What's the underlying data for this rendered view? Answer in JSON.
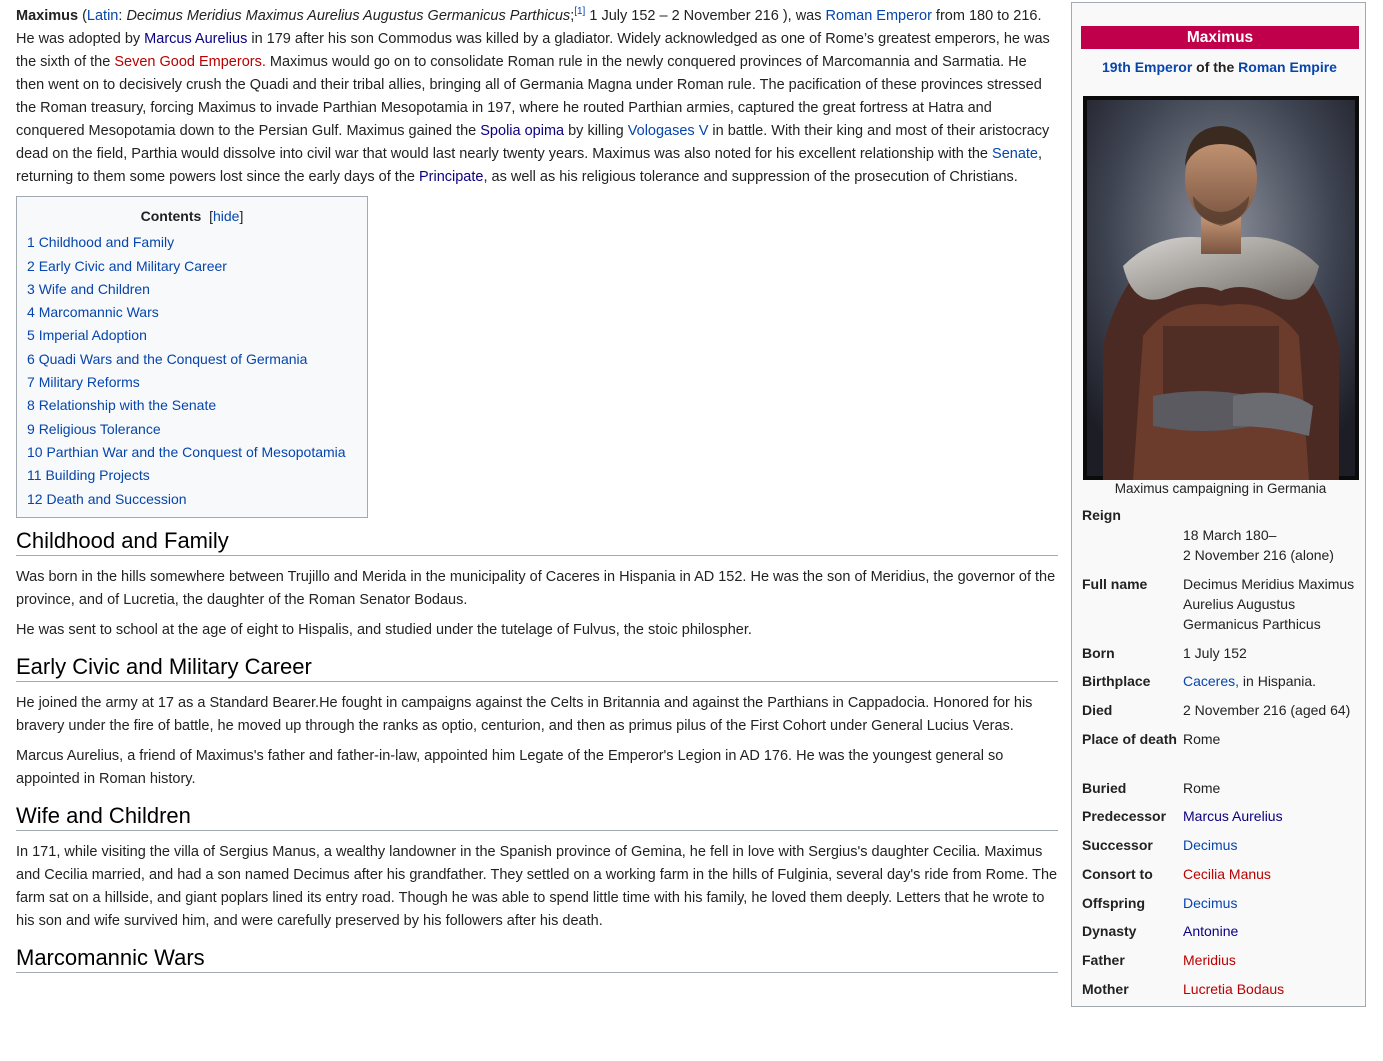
{
  "lead": {
    "name": "Maximus",
    "latin_link": "Latin",
    "latin_name": "Decimus Meridius Maximus Aurelius Augustus Germanicus Parthicus",
    "ref": "[1]",
    "dates": " 1 July 152 – 2 November 216 ), was ",
    "roman_emperor": "Roman Emperor",
    "t1": " from 180 to 216. He was adopted by ",
    "marcus_aurelius": "Marcus Aurelius",
    "t2": " in 179 after his son Commodus was killed by a gladiator. Widely acknowledged as one of Rome’s greatest emperors, he was the sixth of the ",
    "seven_good": "Seven Good Emperors.",
    "t3": " Maximus would go on to consolidate Roman rule in the newly conquered provinces of Marcomannia and Sarmatia. He then went on to decisively crush the Quadi and their tribal allies, bringing all of Germania Magna under Roman rule. The pacification of these provinces stressed the Roman treasury, forcing Maximus to invade Parthian Mesopotamia in 197, where he routed Parthian armies, captured the great fortress at Hatra and conquered Mesopotamia down to the Persian Gulf. Maximus gained the ",
    "spolia": "Spolia opima",
    "t4": " by killing ",
    "vologases": "Vologases V",
    "t5": " in battle. With their king and most of their aristocracy dead on the field, Parthia would dissolve into civil war that would last nearly twenty years. Maximus was also noted for his excellent relationship with the ",
    "senate": "Senate",
    "t6": ", returning to them some powers lost since the early days of the ",
    "principate": "Principate",
    "t7": ", as well as his religious tolerance and suppression of the prosecution of Christians."
  },
  "toc": {
    "title": "Contents",
    "hide": "hide",
    "items": [
      {
        "num": "1",
        "label": "Childhood and Family"
      },
      {
        "num": "2",
        "label": "Early Civic and Military Career"
      },
      {
        "num": "3",
        "label": "Wife and Children"
      },
      {
        "num": "4",
        "label": "Marcomannic Wars"
      },
      {
        "num": "5",
        "label": "Imperial Adoption"
      },
      {
        "num": "6",
        "label": "Quadi Wars and the Conquest of Germania"
      },
      {
        "num": "7",
        "label": "Military Reforms"
      },
      {
        "num": "8",
        "label": "Relationship with the Senate"
      },
      {
        "num": "9",
        "label": "Religious Tolerance"
      },
      {
        "num": "10",
        "label": "Parthian War and the Conquest of Mesopotamia"
      },
      {
        "num": "11",
        "label": "Building Projects"
      },
      {
        "num": "12",
        "label": "Death and Succession"
      }
    ]
  },
  "sections": [
    {
      "heading": "Childhood and Family",
      "paragraphs": [
        "Was born in the hills somewhere between Trujillo and Merida in the municipality of Caceres in Hispania in AD 152. He was the son of Meridius, the governor of the province, and of Lucretia, the daughter of the Roman Senator Bodaus.",
        "He was sent to school at the age of eight to Hispalis, and studied under the tutelage of Fulvus, the stoic philospher."
      ]
    },
    {
      "heading": "Early Civic and Military Career",
      "paragraphs": [
        "He joined the army at 17 as a Standard Bearer.He fought in campaigns against the Celts in Britannia and against the Parthians in Cappadocia. Honored for his bravery under the fire of battle, he moved up through the ranks as optio, centurion, and then as primus pilus of the First Cohort under General Lucius Veras.",
        "Marcus Aurelius, a friend of Maximus's father and father-in-law, appointed him Legate of the Emperor's Legion in AD 176. He was the youngest general so appointed in Roman history."
      ]
    },
    {
      "heading": "Wife and Children",
      "paragraphs": [
        "In 171, while visiting the villa of Sergius Manus, a wealthy landowner in the Spanish province of Gemina, he fell in love with Sergius's daughter Cecilia. Maximus and Cecilia married, and had a son named Decimus after his grandfather. They settled on a working farm in the hills of Fulginia, several day's ride from Rome. The farm sat on a hillside, and giant poplars lined its entry road. Though he was able to spend little time with his family, he loved them deeply. Letters that he wrote to his son and wife survived him, and were carefully preserved by his followers after his death."
      ]
    },
    {
      "heading": "Marcomannic Wars",
      "paragraphs": []
    }
  ],
  "infobox": {
    "title": "Maximus",
    "sub_link1": "19th Emperor",
    "sub_mid": " of the ",
    "sub_link2": "Roman Empire",
    "caption": "Maximus campaigning in Germania",
    "reign_label": "Reign",
    "reign_line1": "18 March 180–",
    "reign_line2": "2 November 216 (alone)",
    "fullname_label": "Full name",
    "fullname_value": "Decimus Meridius Maximus Aurelius Augustus Germanicus Parthicus",
    "born_label": "Born",
    "born_value": "1 July 152",
    "birthplace_label": "Birthplace",
    "birthplace_link": "Caceres,",
    "birthplace_rest": " in Hispania.",
    "died_label": "Died",
    "died_value": "2 November 216 (aged 64)",
    "placeofdeath_label": "Place of death",
    "placeofdeath_value": "Rome",
    "buried_label": "Buried",
    "buried_value": "Rome",
    "predecessor_label": "Predecessor",
    "predecessor_value": "Marcus Aurelius",
    "successor_label": "Successor",
    "successor_value": "Decimus",
    "consort_label": "Consort to",
    "consort_value": "Cecilia Manus",
    "offspring_label": "Offspring",
    "offspring_value": "Decimus",
    "dynasty_label": "Dynasty",
    "dynasty_value": "Antonine",
    "father_label": "Father",
    "father_value": "Meridius",
    "mother_label": "Mother",
    "mother_value": "Lucretia Bodaus"
  }
}
